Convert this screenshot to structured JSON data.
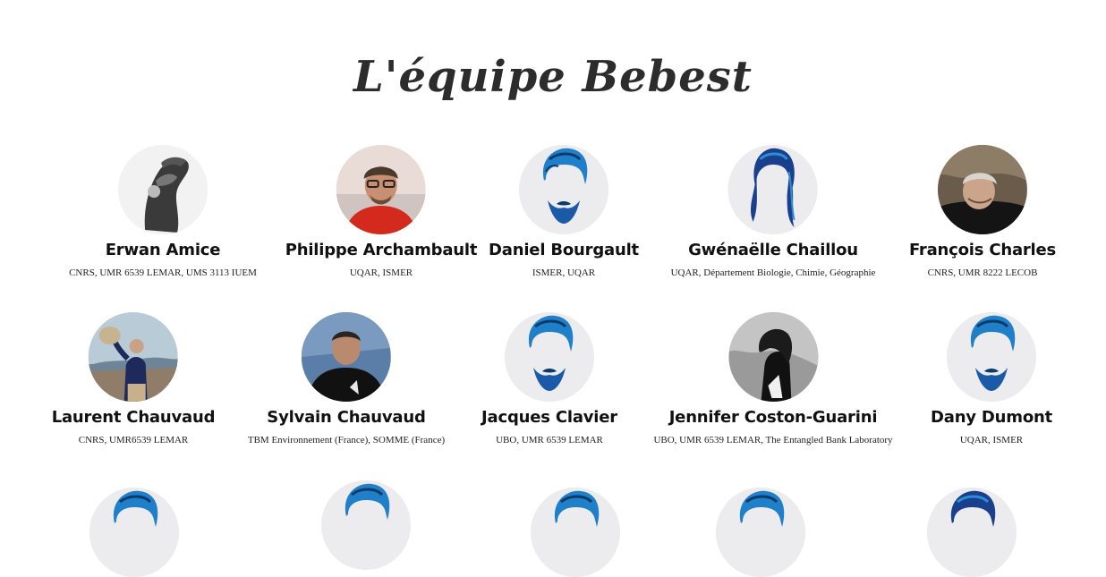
{
  "page": {
    "title": "L'équipe Bebest"
  },
  "members": [
    {
      "name": "Erwan Amice",
      "affiliation": "CNRS, UMR 6539 LEMAR, UMS 3113 IUEM",
      "avatar": "photo-bw-diver-icon"
    },
    {
      "name": "Philippe Archambault",
      "affiliation": "UQAR, ISMER",
      "avatar": "photo-man-red-jacket-icon"
    },
    {
      "name": "Daniel Bourgault",
      "affiliation": "ISMER, UQAR",
      "avatar": "placeholder-man-icon"
    },
    {
      "name": "Gwénaëlle Chaillou",
      "affiliation": "UQAR, Département Biologie, Chimie, Géographie",
      "avatar": "placeholder-woman-icon"
    },
    {
      "name": "François Charles",
      "affiliation": "CNRS, UMR 8222 LECOB",
      "avatar": "photo-man-diving-suit-icon"
    },
    {
      "name": "Laurent Chauvaud",
      "affiliation": "CNRS, UMR6539 LEMAR",
      "avatar": "photo-man-holding-shell-icon"
    },
    {
      "name": "Sylvain Chauvaud",
      "affiliation": "TBM Environnement (France), SOMME (France)",
      "avatar": "photo-man-wetsuit-icon"
    },
    {
      "name": "Jacques Clavier",
      "affiliation": "UBO, UMR 6539 LEMAR",
      "avatar": "placeholder-man-icon"
    },
    {
      "name": "Jennifer Coston-Guarini",
      "affiliation": "UBO, UMR 6539 LEMAR, The Entangled Bank Laboratory",
      "avatar": "photo-bw-woman-icon"
    },
    {
      "name": "Dany Dumont",
      "affiliation": "UQAR, ISMER",
      "avatar": "placeholder-man-icon"
    },
    {
      "name": "",
      "affiliation": "",
      "avatar": "placeholder-man-icon"
    },
    {
      "name": "",
      "affiliation": "",
      "avatar": "placeholder-man-icon"
    },
    {
      "name": "",
      "affiliation": "",
      "avatar": "placeholder-man-icon"
    },
    {
      "name": "",
      "affiliation": "",
      "avatar": "placeholder-man-icon"
    },
    {
      "name": "",
      "affiliation": "",
      "avatar": "placeholder-man-icon"
    }
  ]
}
